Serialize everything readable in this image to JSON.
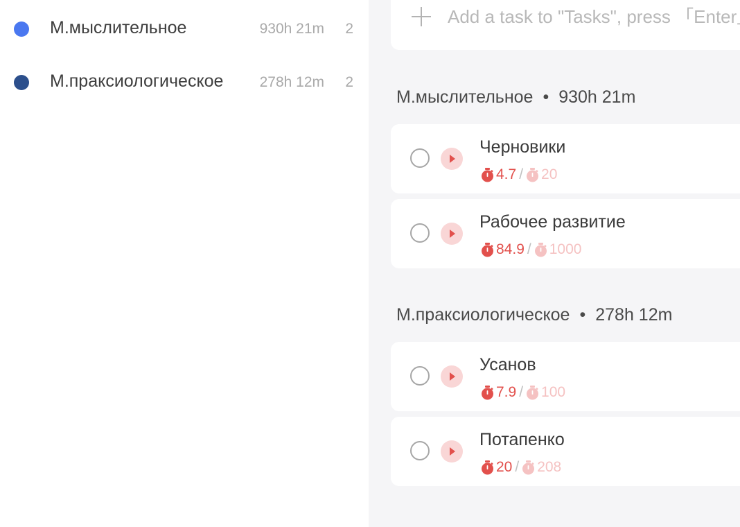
{
  "sidebar": {
    "projects": [
      {
        "name": "М.мыслительное",
        "time": "930h 21m",
        "count": "2",
        "color": "#4a78f0"
      },
      {
        "name": "М.праксиологическое",
        "time": "278h 12m",
        "count": "2",
        "color": "#2c4f8c"
      }
    ]
  },
  "main": {
    "add_task": {
      "placeholder": "Add a task to \"Tasks\", press 「Enter」 to save"
    },
    "groups": [
      {
        "name": "М.мыслительное",
        "separator": "•",
        "time": "930h 21m",
        "tasks": [
          {
            "title": "Черновики",
            "done_pomos": "4.7",
            "slash": "/",
            "est_pomos": "20"
          },
          {
            "title": "Рабочее развитие",
            "done_pomos": "84.9",
            "slash": "/",
            "est_pomos": "1000"
          }
        ]
      },
      {
        "name": "М.праксиологическое",
        "separator": "•",
        "time": "278h 12m",
        "tasks": [
          {
            "title": "Усанов",
            "done_pomos": "7.9",
            "slash": "/",
            "est_pomos": "100"
          },
          {
            "title": "Потапенко",
            "done_pomos": "20",
            "slash": "/",
            "est_pomos": "208"
          }
        ]
      }
    ]
  },
  "colors": {
    "accent_red": "#e2504c",
    "estimate_pink": "#f5c2c2",
    "main_background": "#f5f5f7"
  },
  "icons": {
    "add": "plus-icon",
    "complete": "checkbox-circle-icon",
    "start": "play-icon",
    "pomodoro_done": "stopwatch-filled-icon",
    "pomodoro_estimate": "stopwatch-outline-icon"
  }
}
